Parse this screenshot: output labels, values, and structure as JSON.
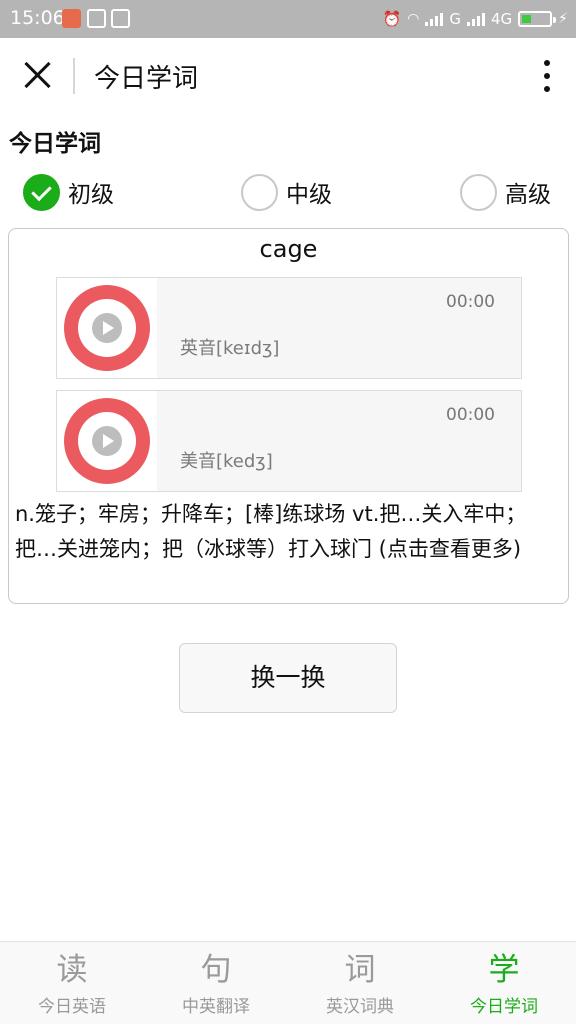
{
  "status_bar": {
    "time": "15:06",
    "network_g": "G",
    "network_4g": "4G",
    "app_icon_colors": [
      "#e66a4c",
      "#3a8ee6",
      "#3a8ee6"
    ]
  },
  "title_bar": {
    "title": "今日学词",
    "close_icon": "close-icon",
    "more_icon": "more-vertical-icon"
  },
  "section_title": "今日学词",
  "levels": [
    {
      "label": "初级",
      "checked": true
    },
    {
      "label": "中级",
      "checked": false
    },
    {
      "label": "高级",
      "checked": false
    }
  ],
  "word_card": {
    "word": "cage",
    "audio": [
      {
        "phonetic": "英音[keɪdʒ]",
        "duration": "00:00"
      },
      {
        "phonetic": "美音[kedʒ]",
        "duration": "00:00"
      }
    ],
    "definition": "n.笼子；牢房；升降车；[棒]练球场 vt.把…关入牢中；把…关进笼内；把（冰球等）打入球门 (点击查看更多)"
  },
  "refresh_button": "换一换",
  "tabs": [
    {
      "icon_char": "读",
      "label": "今日英语",
      "active": false
    },
    {
      "icon_char": "句",
      "label": "中英翻译",
      "active": false
    },
    {
      "icon_char": "词",
      "label": "英汉词典",
      "active": false
    },
    {
      "icon_char": "学",
      "label": "今日学词",
      "active": true
    }
  ],
  "colors": {
    "accent_green": "#1aad19",
    "player_red": "#ea5a5f",
    "status_bar_bg": "#b5b5b5"
  }
}
